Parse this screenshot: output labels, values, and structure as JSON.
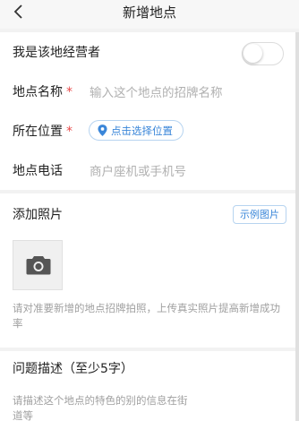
{
  "nav": {
    "title": "新增地点"
  },
  "operator": {
    "label": "我是该地经营者"
  },
  "name": {
    "label": "地点名称",
    "required_mark": "*",
    "placeholder": "输入这个地点的招牌名称"
  },
  "location": {
    "label": "所在位置",
    "required_mark": "*",
    "button": "点击选择位置"
  },
  "phone": {
    "label": "地点电话",
    "placeholder": "商户座机或手机号"
  },
  "photo": {
    "title": "添加照片",
    "example_button": "示例图片",
    "hint": "请对准要新增的地点招牌拍照，上传真实照片提高新增成功率"
  },
  "description": {
    "title": "问题描述（至少5字）",
    "placeholder": "请描述这个地点的特色的别的信息在街道等"
  },
  "colors": {
    "accent": "#3a86d9",
    "required": "#e84a4a",
    "placeholder": "#b0b0b0"
  }
}
